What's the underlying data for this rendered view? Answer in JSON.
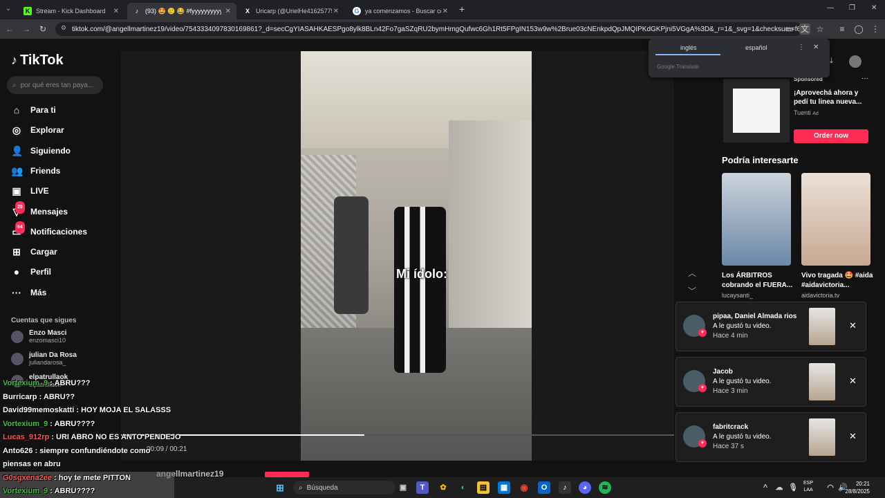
{
  "browser": {
    "tabs": [
      {
        "title": "Stream - Kick Dashboard",
        "favicon": "K",
        "color": "#53fc18",
        "active": false
      },
      {
        "title": "(93) 🤩 🥲 😂 #fyyyyyyyyyyy",
        "favicon": "♪",
        "color": "#ffffff",
        "active": true
      },
      {
        "title": "Uricarp (@UrielHe41625775) /",
        "favicon": "X",
        "color": "#ffffff",
        "active": false
      },
      {
        "title": "ya comenzamos - Buscar con G",
        "favicon": "G",
        "color": "#4285f4",
        "active": false
      }
    ],
    "new_tab": "+",
    "url": "tiktok.com/@angellmartinez19/video/7543334097830169861?_d=secCgYIASAHKAESPgo8ylk8BLn42Fo7gaSZqRU2bymHmgQufwc6Gh1Rt5FPgIN153w9w%2Brue03cNEnkpdQpJMQIPKdGKPjni5VGgA%3D&_r=1&_svg=1&checksum=f616873bc12a1..."
  },
  "translate": {
    "lang_from": "inglés",
    "lang_to": "español",
    "footer": "Google Translate"
  },
  "sidebar": {
    "logo": "TikTok",
    "search_placeholder": "por qué eres tan paya...",
    "nav": [
      {
        "label": "Para ti",
        "icon": "home-icon",
        "glyph": "⌂"
      },
      {
        "label": "Explorar",
        "icon": "compass-icon",
        "glyph": "◎"
      },
      {
        "label": "Siguiendo",
        "icon": "following-icon",
        "glyph": "👤"
      },
      {
        "label": "Friends",
        "icon": "friends-icon",
        "glyph": "👥"
      },
      {
        "label": "LIVE",
        "icon": "live-icon",
        "glyph": "▣"
      },
      {
        "label": "Mensajes",
        "icon": "messages-icon",
        "glyph": "▽",
        "badge": "29"
      },
      {
        "label": "Notificaciones",
        "icon": "bell-icon",
        "glyph": "▭",
        "badge": "64"
      },
      {
        "label": "Cargar",
        "icon": "upload-icon",
        "glyph": "⊞"
      },
      {
        "label": "Perfil",
        "icon": "profile-icon",
        "glyph": "●"
      },
      {
        "label": "Más",
        "icon": "more-icon",
        "glyph": "···"
      }
    ],
    "following_title": "Cuentas que sigues",
    "following": [
      {
        "name": "Enzo Masci",
        "handle": "enzomasci10"
      },
      {
        "name": "julian Da Rosa",
        "handle": "juliandarosa_"
      },
      {
        "name": "elpatrullaok",
        "handle": "elpatrullaok"
      }
    ]
  },
  "video": {
    "overlay_text": "Mi ídolo:",
    "time": "00:09 / 00:21",
    "progress": 0.44,
    "author": "angellmartinez19"
  },
  "right": {
    "ad": {
      "sponsored": "Sponsored",
      "text": "¡Aprovechá ahora y pedí tu linea nueva...",
      "brand": "Tuenti",
      "brand_tag": "Ad",
      "button": "Order now"
    },
    "suggest_title": "Podría interesarte",
    "suggestions": [
      {
        "title": "Los ÁRBITROS cobrando el FUERA...",
        "user": "lucaysanti_"
      },
      {
        "title": "Vivo tragada 🤩 #aida #aidavictoria...",
        "user": "aidavictoria.tv"
      }
    ]
  },
  "notifications": [
    {
      "name": "pipaa, Daniel Almada rios",
      "action": "A le gustó tu video.",
      "time": "Hace 4 min"
    },
    {
      "name": "Jacob",
      "action": "A le gustó tu video.",
      "time": "Hace 3 min"
    },
    {
      "name": "fabritcrack",
      "action": "A le gustó tu video.",
      "time": "Hace 37 s"
    }
  ],
  "chat": [
    {
      "user": "Vortexium_9",
      "msg": ": ABRU???",
      "color": "#3fc13f"
    },
    {
      "user": "Burricarp",
      "msg": ": ABRU??",
      "color": "#ffffff"
    },
    {
      "user": "David99memoskatti",
      "msg": ": HOY MOJA EL SALASSS",
      "color": "#ffffff"
    },
    {
      "user": "Vortexium_9",
      "msg": ": ABRU????",
      "color": "#3fc13f"
    },
    {
      "user": "Lucas_912rp",
      "msg": ": URI ABRO NO ES ANTO PENDEJO",
      "color": "#ff5555"
    },
    {
      "user": "Anto626",
      "msg": ": siempre confundiéndote como",
      "color": "#ffffff"
    },
    {
      "user": "",
      "msg": "piensas en abru",
      "color": "#ffffff"
    },
    {
      "user": "G0sgxena2ee",
      "msg": ": hoy te mete PITTON",
      "color": "#ff5555"
    },
    {
      "user": "Vortexium_9",
      "msg": ": ABRU????",
      "color": "#3fc13f"
    }
  ],
  "taskbar": {
    "search": "Búsqueda",
    "lang": "ESP",
    "lang2": "LAA",
    "time": "20:21",
    "date": "28/8/2025"
  }
}
